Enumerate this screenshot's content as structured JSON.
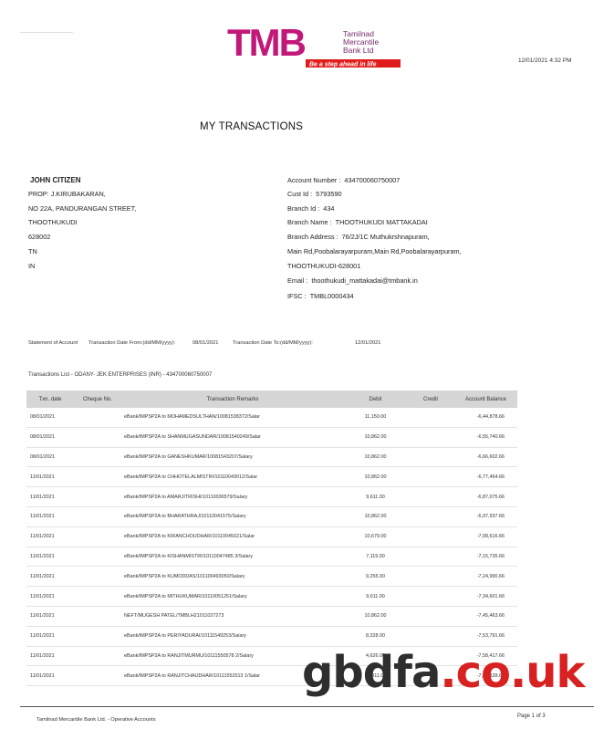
{
  "bank": {
    "logo_letters": "TMB",
    "name_line1": "Tamilnad",
    "name_line2": "Mercantile",
    "name_line3": "Bank Ltd",
    "tagline": "Be a step ahead in life"
  },
  "timestamp": "12/01/2021 4:32 PM",
  "title": "MY TRANSACTIONS",
  "customer": {
    "name": "JOHN CITIZEN",
    "address": [
      "PROP: J.KIRUBAKARAN,",
      "NO 22A, PANDURANGAN STREET,",
      "THOOTHUKUDI",
      "628002",
      "TN",
      "IN"
    ]
  },
  "account": {
    "number_label": "Account Number :",
    "number": "434700060750007",
    "cust_label": "Cust Id :",
    "cust": "5793590",
    "branch_id_label": "Branch Id :",
    "branch_id": "434",
    "branch_name_label": "Branch Name :",
    "branch_name": "THOOTHUKUDI MATTAKADAI",
    "branch_address_label": "Branch Address :",
    "branch_address_1": "76/2J/1C Muthukrshnapuram,",
    "branch_address_2": "Main Rd,Poobalarayarpuram,Main Rd,Poobalarayarpuram,",
    "branch_address_3": "THOOTHUKUDI-628001",
    "email_label": "Email :",
    "email": "thoothukudi_mattakadai@tmbank.in",
    "ifsc_label": "IFSC :",
    "ifsc": "TMBL0000434"
  },
  "statement": {
    "label": "Statement of Account",
    "from_label": "Transaction Date From:(dd/MM/yyyy):",
    "from": "08/01/2021",
    "to_label": "Transaction Date To:(dd/MM/yyyy):",
    "to": "12/01/2021"
  },
  "transactions_list_label": "Transactions List - ODANY- JEK ENTERPRISES (INR) - 434700060750007",
  "table": {
    "headers": [
      "Txn. date",
      "Cheque No.",
      "Transaction Remarks",
      "Debit",
      "Credit",
      "Account Balance"
    ],
    "rows": [
      {
        "date": "08/01/2021",
        "cheque": "",
        "remarks": "eBank/IMPSP2A to MOHAMEDSULTHAN/10081538372/Salar",
        "debit": "11,150.00",
        "credit": "",
        "balance": "-6,44,878.66"
      },
      {
        "date": "08/01/2021",
        "cheque": "",
        "remarks": "eBank/IMPSP2A to SHANMUGASUNDAR/10081540249/Salar",
        "debit": "10,862.00",
        "credit": "",
        "balance": "-6,55,740.66"
      },
      {
        "date": "08/01/2021",
        "cheque": "",
        "remarks": "eBank/IMPSP2A to GANESHKUMAR/10081543207/Salary",
        "debit": "10,862.00",
        "credit": "",
        "balance": "-6,66,602.66"
      },
      {
        "date": "11/01/2021",
        "cheque": "",
        "remarks": "eBank/IMPSP2A to CHHOTELALMISTRI/10110043012/Salar",
        "debit": "10,862.00",
        "credit": "",
        "balance": "-6,77,464.66"
      },
      {
        "date": "11/01/2021",
        "cheque": "",
        "remarks": "eBank/IMPSP2A to AMARJITRISHI/10110036579/Salary",
        "debit": "9,611.00",
        "credit": "",
        "balance": "-6,87,075.66"
      },
      {
        "date": "11/01/2021",
        "cheque": "",
        "remarks": "eBank/IMPSP2A to BHARATHRAJ/10110041575/Salary",
        "debit": "10,862.00",
        "credit": "",
        "balance": "-6,97,937.66"
      },
      {
        "date": "11/01/2021",
        "cheque": "",
        "remarks": "eBank/IMPSP2A to KIRANCHOUDHAR/10110045021/Salar",
        "debit": "10,679.00",
        "credit": "",
        "balance": "-7,08,616.66"
      },
      {
        "date": "11/01/2021",
        "cheque": "",
        "remarks": "eBank/IMPSP2A to KISHANMISTRI/10110047485 3/Salary",
        "debit": "7,119.00",
        "credit": "",
        "balance": "-7,15,735.66"
      },
      {
        "date": "11/01/2021",
        "cheque": "",
        "remarks": "eBank/IMPSP2A to KUMODDAS/101100493050/Salary",
        "debit": "9,255.00",
        "credit": "",
        "balance": "-7,24,990.66"
      },
      {
        "date": "11/01/2021",
        "cheque": "",
        "remarks": "eBank/IMPSP2A to MITHUKUMAR/10110051251/Salary",
        "debit": "9,611.00",
        "credit": "",
        "balance": "-7,34,601.66"
      },
      {
        "date": "11/01/2021",
        "cheque": "",
        "remarks": "NEFT/MUGESH PATEL/TMBLH21011027273",
        "debit": "10,862.00",
        "credit": "",
        "balance": "-7,45,463.66"
      },
      {
        "date": "11/01/2021",
        "cheque": "",
        "remarks": "eBank/IMPSP2A to PERIYADURAI/10111549253/Salary",
        "debit": "8,328.00",
        "credit": "",
        "balance": "-7,53,791.66"
      },
      {
        "date": "11/01/2021",
        "cheque": "",
        "remarks": "eBank/IMPSP2A to RANJITMURMU/10111550578 2/Salary",
        "debit": "4,626.00",
        "credit": "",
        "balance": "-7,58,417.66"
      },
      {
        "date": "11/01/2021",
        "cheque": "",
        "remarks": "eBank/IMPSP2A to RANJITCHAUDHAR/10111552513 1/Salar",
        "debit": "10,911.00",
        "credit": "",
        "balance": "-7,69,328.66"
      }
    ]
  },
  "watermark": {
    "part1": "gbdfa",
    "dot": ".",
    "part2": "co",
    "dot2": ".",
    "part3": "uk"
  },
  "footer": {
    "left": "Tamilnad Mercantile Bank Ltd. - Operative Accounts",
    "right": "Page 1 of 3"
  },
  "colors": {
    "logo_magenta": "#c2187a",
    "logo_text": "#7a2a6e",
    "tagline_bg": "#e21b1b",
    "header_row": "#d6d6d6",
    "watermark_red": "#d82121"
  }
}
